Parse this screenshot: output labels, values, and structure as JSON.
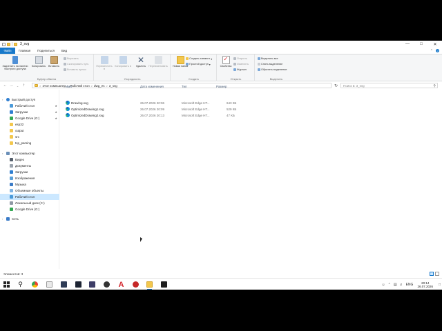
{
  "window": {
    "title": "3_svg"
  },
  "colors": {
    "accent": "#1979ca",
    "folder": "#f3c74c",
    "selected": "#cce8ff"
  },
  "ribbon": {
    "tabs": [
      "Файл",
      "Главная",
      "Поделиться",
      "Вид"
    ],
    "clipboard": {
      "label": "Буфер обмена",
      "pin": "Закрепить на панели быстрого доступа",
      "copy": "Копировать",
      "paste": "Вставить",
      "cut": "Вырезать",
      "copy_path": "Скопировать путь",
      "paste_shortcut": "Вставить ярлык"
    },
    "organize": {
      "label": "Упорядочить",
      "move": "Переместить в",
      "copy_to": "Копировать в",
      "delete": "Удалить",
      "rename": "Переименовать"
    },
    "create": {
      "label": "Создать",
      "new_folder": "Новая папка",
      "new_item": "Создать элемент",
      "easy_access": "Простой доступ"
    },
    "open": {
      "label": "Открыть",
      "properties": "Свойства",
      "open": "Открыть",
      "edit": "Изменить",
      "history": "Журнал"
    },
    "select": {
      "label": "Выделить",
      "select_all": "Выделить все",
      "select_none": "Снять выделение",
      "invert": "Обратить выделение"
    }
  },
  "address": {
    "crumbs": [
      "Этот компьютер",
      "Рабочий стол",
      "dwg_es",
      "3_svg"
    ],
    "search_placeholder": "Поиск в: 3_svg"
  },
  "nav": {
    "quick_access": "Быстрый доступ",
    "quick_items": [
      {
        "label": "Рабочий стол",
        "icon": "desktop-icon",
        "pinned": true
      },
      {
        "label": "Загрузки",
        "icon": "downloads-icon",
        "pinned": true
      },
      {
        "label": "Google Drive (G:)",
        "icon": "google-drive-icon",
        "pinned": true
      },
      {
        "label": "esp32",
        "icon": "folder-icon",
        "pinned": false
      },
      {
        "label": "output",
        "icon": "folder-icon",
        "pinned": false
      },
      {
        "label": "src",
        "icon": "folder-icon",
        "pinned": false
      },
      {
        "label": "tcp_parsing",
        "icon": "folder-icon",
        "pinned": false
      }
    ],
    "this_pc": "Этот компьютер",
    "pc_items": [
      {
        "label": "Видео",
        "icon": "video-icon"
      },
      {
        "label": "Документы",
        "icon": "documents-icon"
      },
      {
        "label": "Загрузки",
        "icon": "downloads-icon"
      },
      {
        "label": "Изображения",
        "icon": "pictures-icon"
      },
      {
        "label": "Музыка",
        "icon": "music-icon"
      },
      {
        "label": "Объемные объекты",
        "icon": "3d-objects-icon"
      },
      {
        "label": "Рабочий стол",
        "icon": "desktop-icon",
        "selected": true
      },
      {
        "label": "Локальный диск (C:)",
        "icon": "drive-icon"
      },
      {
        "label": "Google Drive (G:)",
        "icon": "google-drive-icon"
      }
    ],
    "network": "Сеть"
  },
  "files": {
    "columns": [
      "Имя",
      "Дата изменения",
      "Тип",
      "Размер"
    ],
    "rows": [
      {
        "name": "Drawing.svg",
        "date": "26.07.2026 20:06",
        "type": "Microsoft Edge HT...",
        "size": "643 КБ"
      },
      {
        "name": "OptimizedDrawing1.svg",
        "date": "26.07.2026 20:09",
        "type": "Microsoft Edge HT...",
        "size": "529 КБ"
      },
      {
        "name": "OptimizedDrawing2.svg",
        "date": "26.07.2026 20:13",
        "type": "Microsoft Edge HT...",
        "size": "47 КБ"
      }
    ]
  },
  "status": {
    "count": "Элементов: 3"
  },
  "taskbar": {
    "apps": [
      "start",
      "search",
      "chrome",
      "file-manager",
      "app-vk",
      "app-ax",
      "app-brain",
      "autocad",
      "app-red",
      "explorer",
      "terminal"
    ],
    "tray": {
      "lang": "ENG",
      "time": "20:14",
      "date": "26.07.2026"
    }
  }
}
